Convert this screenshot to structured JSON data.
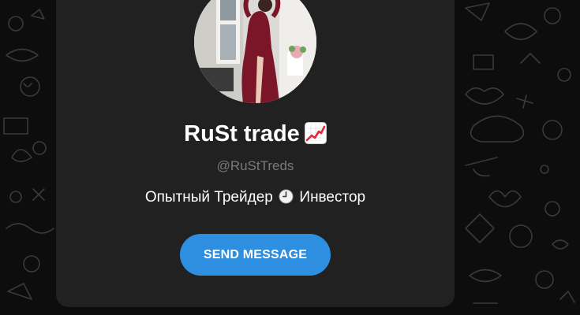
{
  "profile": {
    "name": "RuSt trade",
    "name_emoji": "chart-increasing-icon",
    "handle": "@RuStTreds",
    "bio_part1": "Опытный Трейдер",
    "bio_emoji": "clock-icon",
    "bio_part2": "Инвестор"
  },
  "actions": {
    "send_message_label": "SEND MESSAGE"
  },
  "colors": {
    "background": "#0d0d0d",
    "card": "#212121",
    "button": "#2e8fe0",
    "handle_text": "#7a7a7a"
  }
}
